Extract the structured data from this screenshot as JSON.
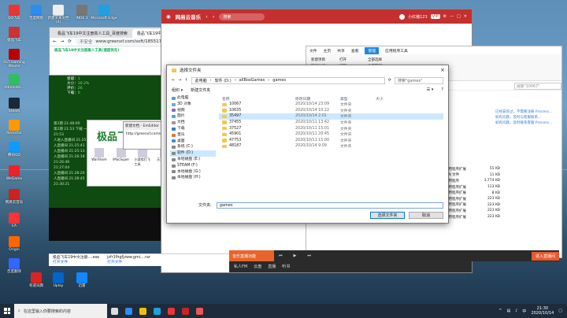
{
  "desktop_icons": [
    {
      "label": "QQ飞车",
      "color": "#e33"
    },
    {
      "label": "百度网盘",
      "color": "#2d8cf0"
    },
    {
      "label": "新建文本文档 (4)",
      "color": "#eee"
    },
    {
      "label": "INDE 3",
      "color": "#777"
    },
    {
      "label": "Microsoft Edge",
      "color": "#1fa1e0"
    },
    {
      "label": "极品飞车",
      "color": "#c33"
    },
    {
      "label": "SST Gaming Mouse",
      "color": "#b00"
    },
    {
      "label": "Administr...",
      "color": "#3b6"
    },
    {
      "label": "Steam",
      "color": "#1b2838"
    },
    {
      "label": "Rockstar",
      "color": "#f90"
    },
    {
      "label": "腾讯QQ",
      "color": "#19f"
    },
    {
      "label": "WeGame",
      "color": "#e22"
    },
    {
      "label": "网易云音乐",
      "color": "#c22"
    },
    {
      "label": "EA",
      "color": "#f33"
    },
    {
      "label": "Origin",
      "color": "#f60"
    },
    {
      "label": "百度翻译",
      "color": "#36f"
    },
    {
      "label": "有道词典",
      "color": "#d22"
    },
    {
      "label": "Uplay",
      "color": "#06c"
    },
    {
      "label": "迅雷",
      "color": "#18f"
    },
    {
      "label": "UU加速器",
      "color": "#2a2"
    },
    {
      "label": "酷狗音乐",
      "color": "#27f"
    },
    {
      "label": "哔哩哔哩",
      "color": "#f6a"
    },
    {
      "label": "向日葵",
      "color": "#f80"
    },
    {
      "label": "GeForce Experience",
      "color": "#76b900"
    }
  ],
  "browser": {
    "tab1": "极品飞车19中文注册高人工具_百度搜索",
    "tab2": "极品飞车19中文注册高人工具_青...",
    "insecure": "不安全",
    "url": "www.greenxf.com/soft/185517.html",
    "page_heading": "极品飞车19中文注册高人工具(速度优先)"
  },
  "stats": [
    {
      "k": "星级：",
      "v": "1"
    },
    {
      "k": "大小：",
      "v": "30.2%"
    },
    {
      "k": "评价：",
      "v": "26"
    },
    {
      "k": "下载：",
      "v": "0"
    }
  ],
  "green_lines": [
    "第2期 21:48:00",
    "第2期 21:53 下载 一个都不错",
    "21:53",
    "人进入直播间 21:25:16",
    "入直播间 21:25:41",
    "入直播间 21:25:13",
    "入直播间 21:26:18",
    "21:26:46",
    "21:27:04",
    "入直播间 21:28:20",
    "人直播间 21:28:45",
    "21:30:21"
  ],
  "overlay": {
    "heading": "极品飞车",
    "icons": [
      "WarShare",
      "iMacSuper",
      "小游戏打飞工具",
      "天龙八表台"
    ]
  },
  "editor": {
    "title": "新建文档 - EmEditor",
    "content": "http://greenxf.com/gre..."
  },
  "music": {
    "brand": "网易云音乐",
    "search": "搜索",
    "user": "小红猪123",
    "vip": "VIP",
    "bottom_items": [
      "私人FM",
      "云盘",
      "直播",
      "听书"
    ],
    "live_btn": "进入直播间"
  },
  "explorer": {
    "tabs": [
      "文件",
      "主页",
      "共享",
      "查看",
      "管理",
      "应用程序工具"
    ],
    "active_tab": "管理",
    "address_value": "10067",
    "ribbon_groups": [
      [
        "新建项目",
        "轻松访问"
      ],
      [
        "打开",
        "编辑",
        "历史记录"
      ],
      [
        "全部选择",
        "全部取消",
        "反向选择"
      ]
    ],
    "ribbon_labels": [
      "新建",
      "打开",
      "选择"
    ],
    "search_placeholder": "搜索\"10067\"",
    "rows": [
      {
        "date": "2020/7/23 17:40",
        "type": "应用程序扩展",
        "size": "55 KB"
      },
      {
        "date": "2020/10/14 16:50",
        "type": "BIN 文件",
        "size": "11 KB"
      },
      {
        "date": "2020/10/14 16:50",
        "type": "应用程序",
        "size": "3,774 KB"
      },
      {
        "date": "2020/7/23 17:40",
        "type": "应用程序扩展",
        "size": "113 KB"
      },
      {
        "date": "2020/7/23 17:40",
        "type": "应用程序扩展",
        "size": "8 KB"
      },
      {
        "date": "2020/7/23 17:40",
        "type": "应用程序扩展",
        "size": "223 KB"
      },
      {
        "date": "2020/7/23 17:40",
        "type": "应用程序扩展",
        "size": "223 KB"
      },
      {
        "date": "2020/7/23 17:40",
        "type": "应用程序扩展",
        "size": "223 KB"
      },
      {
        "date": "2020/7/23 17:40",
        "type": "应用程序扩展",
        "size": "223 KB"
      }
    ],
    "blue_notes": [
      "已经安装过，不需要注册 Process...",
      "如有问题，及时与客服联系...",
      "如有问题，及时联系客服 Process..."
    ]
  },
  "dialog": {
    "title": "选择文件夹",
    "close": "×",
    "breadcrumb": [
      "此电脑",
      "软件 (D:)",
      "allBoxGames",
      "games"
    ],
    "search_placeholder": "搜索\"games\"",
    "organize": "组织 ▾",
    "new_folder": "新建文件夹",
    "columns": [
      "名称",
      "修改日期",
      "类型",
      "大小"
    ],
    "tree": [
      {
        "label": "此电脑",
        "color": "#5b9bd5"
      },
      {
        "label": "3D 对象",
        "color": "#6aa9e0"
      },
      {
        "label": "视频",
        "color": "#7e6cc6"
      },
      {
        "label": "图片",
        "color": "#4da6d8"
      },
      {
        "label": "文档",
        "color": "#999"
      },
      {
        "label": "下载",
        "color": "#2d7cd6"
      },
      {
        "label": "音乐",
        "color": "#e2763a"
      },
      {
        "label": "桌面",
        "color": "#3b8ede"
      },
      {
        "label": "系统 (C:)",
        "color": "#888"
      },
      {
        "label": "软件 (D:)",
        "color": "#888"
      },
      {
        "label": "本地磁盘 (E:)",
        "color": "#888"
      },
      {
        "label": "STEAM (F:)",
        "color": "#888"
      },
      {
        "label": "本地磁盘 (G:)",
        "color": "#888"
      },
      {
        "label": "本地磁盘 (H:)",
        "color": "#888"
      }
    ],
    "selected_tree_index": 9,
    "files": [
      {
        "name": "10067",
        "date": "2020/10/14 23:09",
        "type": "文件夹"
      },
      {
        "name": "10635",
        "date": "2020/10/14 10:22",
        "type": "文件夹"
      },
      {
        "name": "35497",
        "date": "2020/10/14 2:01",
        "type": "文件夹"
      },
      {
        "name": "37455",
        "date": "2020/10/11 13:42",
        "type": "文件夹"
      },
      {
        "name": "37527",
        "date": "2020/10/11 15:01",
        "type": "文件夹"
      },
      {
        "name": "45901",
        "date": "2020/10/11 20:45",
        "type": "文件夹"
      },
      {
        "name": "47753",
        "date": "2020/10/11 15:00",
        "type": "文件夹"
      },
      {
        "name": "48187",
        "date": "2020/10/14 9:09",
        "type": "文件夹"
      }
    ],
    "selected_file_index": 2,
    "folder_label": "文件夹:",
    "folder_value": "games",
    "ok": "选择文件夹",
    "cancel": "取消"
  },
  "downloads": [
    {
      "name": "极品飞车19中文注册....exe",
      "action": "打开文件"
    },
    {
      "name": "jzfr1fhgfjzww.gmi....rar",
      "action": "打开文件"
    }
  ],
  "orange_bar": "音乐直播功能",
  "taskbar": {
    "search_placeholder": "在这里输入你要搜索的内容",
    "apps": [
      "#ddd",
      "#2d8cf0",
      "#f0c000",
      "#1fa1e0",
      "#e33",
      "#c22",
      "#e55"
    ],
    "time": "21:30",
    "date": "2020/10/14",
    "lang": "中"
  }
}
